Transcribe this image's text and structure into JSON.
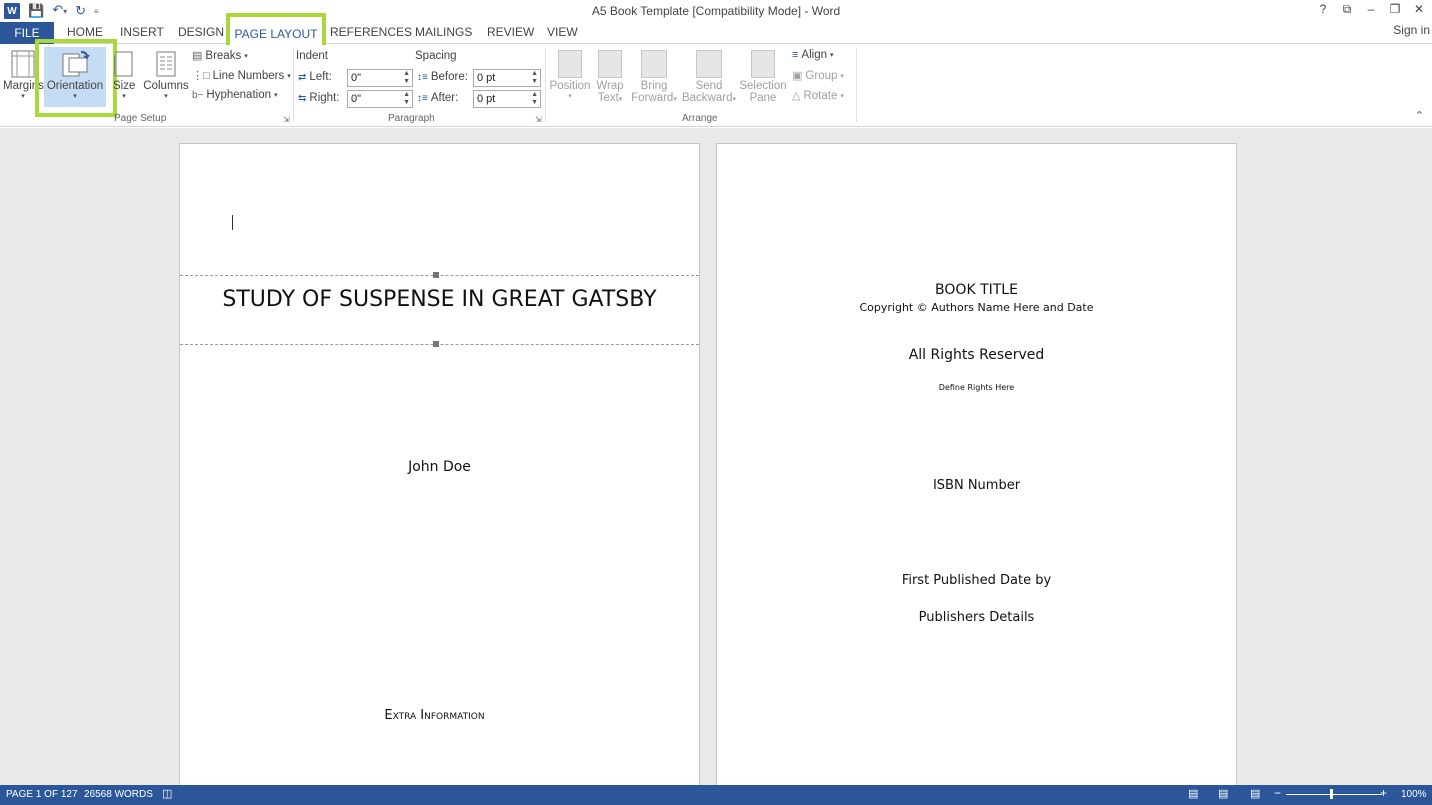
{
  "app": {
    "title": "A5 Book Template [Compatibility Mode] - Word",
    "window_controls": [
      "?",
      "⧉",
      "–",
      "❐",
      "✕"
    ],
    "sign_in": "Sign in"
  },
  "tabs": {
    "file": "FILE",
    "home": "HOME",
    "insert": "INSERT",
    "design": "DESIGN",
    "page_layout": "PAGE LAYOUT",
    "references": "REFERENCES",
    "mailings": "MAILINGS",
    "review": "REVIEW",
    "view": "VIEW",
    "active": "PAGE LAYOUT"
  },
  "ribbon": {
    "page_setup": {
      "margins": "Margins",
      "orientation": "Orientation",
      "size": "Size",
      "columns": "Columns",
      "breaks": "Breaks",
      "line_numbers": "Line Numbers",
      "hyphenation": "Hyphenation",
      "group_label": "Page Setup"
    },
    "paragraph": {
      "indent_label": "Indent",
      "spacing_label": "Spacing",
      "left_label": "Left:",
      "left_value": "0\"",
      "right_label": "Right:",
      "right_value": "0\"",
      "before_label": "Before:",
      "before_value": "0 pt",
      "after_label": "After:",
      "after_value": "0 pt",
      "group_label": "Paragraph"
    },
    "arrange": {
      "position": "Position",
      "wrap_text_1": "Wrap",
      "wrap_text_2": "Text",
      "bring_forward_1": "Bring",
      "bring_forward_2": "Forward",
      "send_backward_1": "Send",
      "send_backward_2": "Backward",
      "selection_pane_1": "Selection",
      "selection_pane_2": "Pane",
      "align": "Align",
      "group": "Group",
      "rotate": "Rotate",
      "group_label": "Arrange"
    }
  },
  "document": {
    "page1": {
      "title": "STUDY OF SUSPENSE IN GREAT GATSBY",
      "author": "John Doe",
      "extra": "Extra Information"
    },
    "page2": {
      "book_title": "BOOK TITLE",
      "copyright": "Copyright © Authors Name Here and Date",
      "rights": "All Rights Reserved",
      "define_rights": "Define Rights Here",
      "isbn": "ISBN Number",
      "first_published": "First Published Date by",
      "publisher": "Publishers Details"
    }
  },
  "status": {
    "page": "PAGE 1 OF 127",
    "words": "26568 WORDS",
    "zoom": "100%"
  },
  "colors": {
    "accent": "#2b579a",
    "highlight": "#a9d83a"
  }
}
